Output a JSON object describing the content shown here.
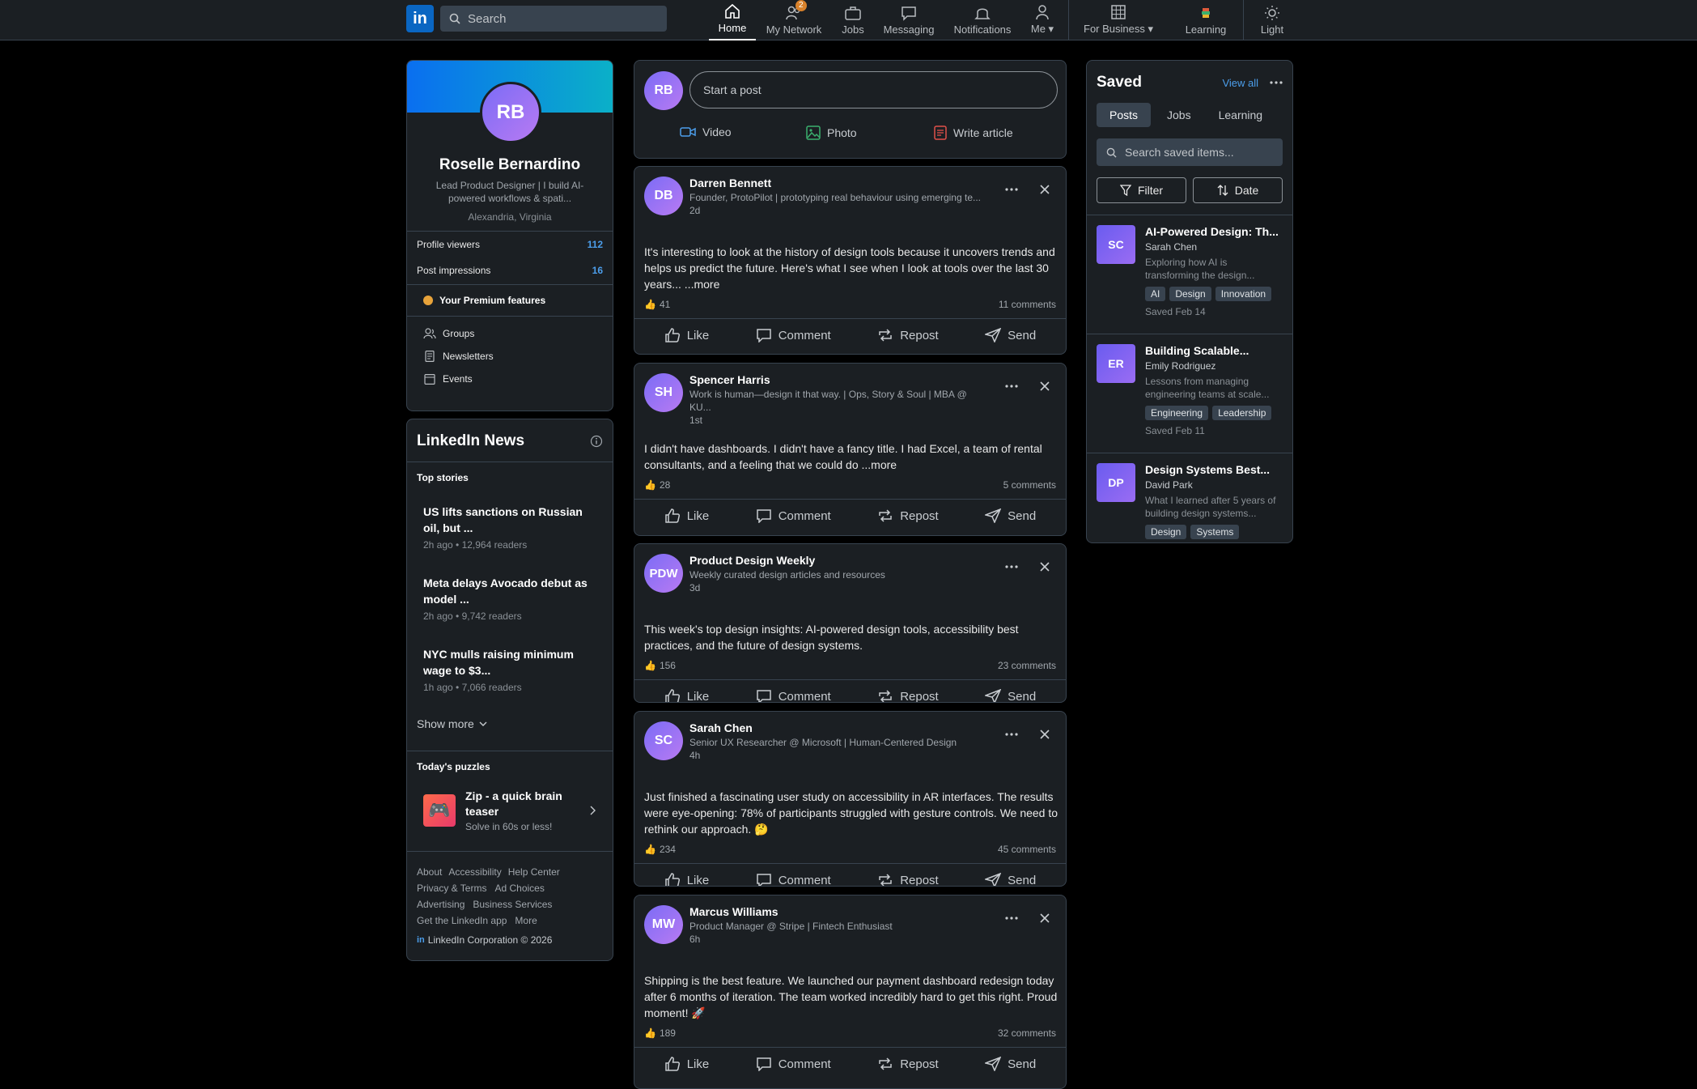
{
  "nav": {
    "logo": "in",
    "search_placeholder": "Search",
    "items": [
      {
        "label": "Home"
      },
      {
        "label": "My Network",
        "badge": "2"
      },
      {
        "label": "Jobs"
      },
      {
        "label": "Messaging"
      },
      {
        "label": "Notifications"
      },
      {
        "label": "Me ▾"
      },
      {
        "label": "For Business ▾"
      },
      {
        "label": "Learning"
      },
      {
        "label": "Light"
      }
    ]
  },
  "profile": {
    "initials": "RB",
    "name": "Roselle Bernardino",
    "headline": "Lead Product Designer | I build AI-powered workflows & spati...",
    "location": "Alexandria, Virginia",
    "viewers_label": "Profile viewers",
    "viewers_value": "112",
    "impressions_label": "Post impressions",
    "impressions_value": "16",
    "premium": "Your Premium features",
    "links": [
      "Groups",
      "Newsletters",
      "Events"
    ]
  },
  "news": {
    "title": "LinkedIn News",
    "top_stories": "Top stories",
    "stories": [
      {
        "title": "US lifts sanctions on Russian oil, but ...",
        "meta": "2h ago • 12,964 readers"
      },
      {
        "title": "Meta delays Avocado debut as model ...",
        "meta": "2h ago • 9,742 readers"
      },
      {
        "title": "NYC mulls raising minimum wage to $3...",
        "meta": "1h ago • 7,066 readers"
      }
    ],
    "show_more": "Show more",
    "puzzles_title": "Today's puzzles",
    "puzzle_name": "Zip - a quick brain teaser",
    "puzzle_sub": "Solve in 60s or less!"
  },
  "footer": {
    "links": [
      "About",
      "Accessibility",
      "Help Center",
      "Privacy & Terms",
      "Ad Choices",
      "Advertising",
      "Business Services",
      "Get the LinkedIn app",
      "More"
    ],
    "corp": "LinkedIn Corporation © 2026"
  },
  "composer": {
    "initials": "RB",
    "placeholder": "Start a post",
    "video": "Video",
    "photo": "Photo",
    "article": "Write article"
  },
  "actions": {
    "like": "Like",
    "comment": "Comment",
    "repost": "Repost",
    "send": "Send"
  },
  "posts": [
    {
      "initials": "DB",
      "name": "Darren Bennett",
      "headline": "Founder, ProtoPilot | prototyping real behaviour using emerging te...",
      "time": "2d",
      "body": "It's interesting to look at the history of design tools because it uncovers trends and helps us predict the future. Here's what I see when I look at tools over the last 30 years... ...more",
      "reactions": "41",
      "comments": "11 comments"
    },
    {
      "initials": "SH",
      "name": "Spencer Harris",
      "headline": "Work is human—design it that way. | Ops, Story & Soul | MBA @ KU...",
      "time": "1st",
      "body": "I didn't have dashboards. I didn't have a fancy title. I had Excel, a team of rental consultants, and a feeling that we could do ...more",
      "reactions": "28",
      "comments": "5 comments"
    },
    {
      "initials": "PDW",
      "name": "Product Design Weekly",
      "headline": "Weekly curated design articles and resources",
      "time": "3d",
      "body": "This week's top design insights: AI-powered design tools, accessibility best practices, and the future of design systems.",
      "reactions": "156",
      "comments": "23 comments"
    },
    {
      "initials": "SC",
      "name": "Sarah Chen",
      "headline": "Senior UX Researcher @ Microsoft | Human-Centered Design",
      "time": "4h",
      "body": "Just finished a fascinating user study on accessibility in AR interfaces. The results were eye-opening: 78% of participants struggled with gesture controls. We need to rethink our approach. 🤔",
      "reactions": "234",
      "comments": "45 comments"
    },
    {
      "initials": "MW",
      "name": "Marcus Williams",
      "headline": "Product Manager @ Stripe | Fintech Enthusiast",
      "time": "6h",
      "body": "Shipping is the best feature. We launched our payment dashboard redesign today after 6 months of iteration. The team worked incredibly hard to get this right. Proud moment! 🚀",
      "reactions": "189",
      "comments": "32 comments"
    }
  ],
  "saved": {
    "title": "Saved",
    "view_all": "View all",
    "tabs": [
      "Posts",
      "Jobs",
      "Learning"
    ],
    "search_placeholder": "Search saved items...",
    "filter": "Filter",
    "date": "Date",
    "items": [
      {
        "initials": "SC",
        "title": "AI-Powered Design: Th...",
        "author": "Sarah Chen",
        "desc": "Exploring how AI is transforming the design...",
        "tags": [
          "AI",
          "Design",
          "Innovation"
        ],
        "saved": "Saved Feb 14"
      },
      {
        "initials": "ER",
        "title": "Building Scalable...",
        "author": "Emily Rodriguez",
        "desc": "Lessons from managing engineering teams at scale...",
        "tags": [
          "Engineering",
          "Leadership"
        ],
        "saved": "Saved Feb 11"
      },
      {
        "initials": "DP",
        "title": "Design Systems Best...",
        "author": "David Park",
        "desc": "What I learned after 5 years of building design systems...",
        "tags": [
          "Design",
          "Systems"
        ],
        "saved": ""
      }
    ]
  }
}
